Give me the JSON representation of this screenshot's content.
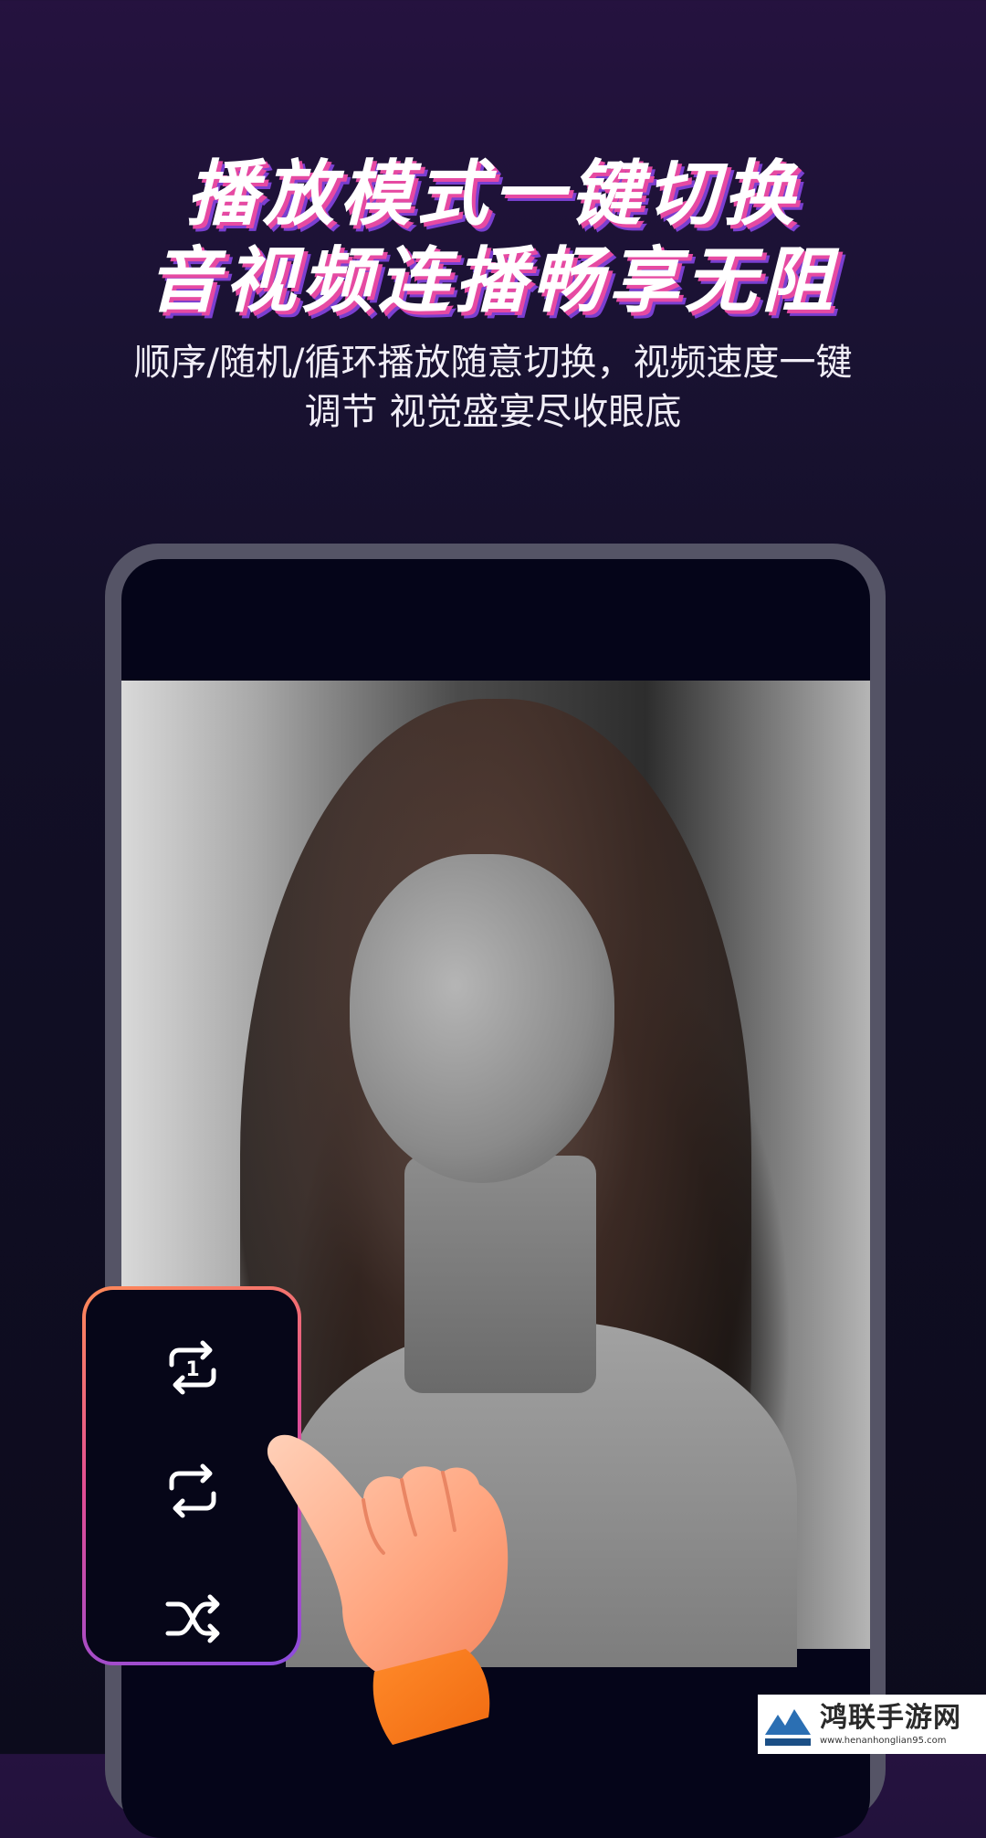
{
  "promo": {
    "headline_line1": "播放模式一键切换",
    "headline_line2": "音视频连播畅享无阻",
    "subtitle_line1": "顺序/随机/循环播放随意切换，视频速度一键",
    "subtitle_line2": "调节  视觉盛宴尽收眼底"
  },
  "player": {
    "modes": [
      {
        "icon": "repeat-one-icon"
      },
      {
        "icon": "repeat-icon"
      },
      {
        "icon": "shuffle-icon"
      }
    ]
  },
  "watermark": {
    "title": "鸿联手游网",
    "url": "www.henanhonglian95.com"
  },
  "colors": {
    "accent_pink": "#e64aa2",
    "accent_purple": "#7a3fd0",
    "accent_orange": "#ff8a57",
    "background_dark": "#0c0b1c"
  }
}
